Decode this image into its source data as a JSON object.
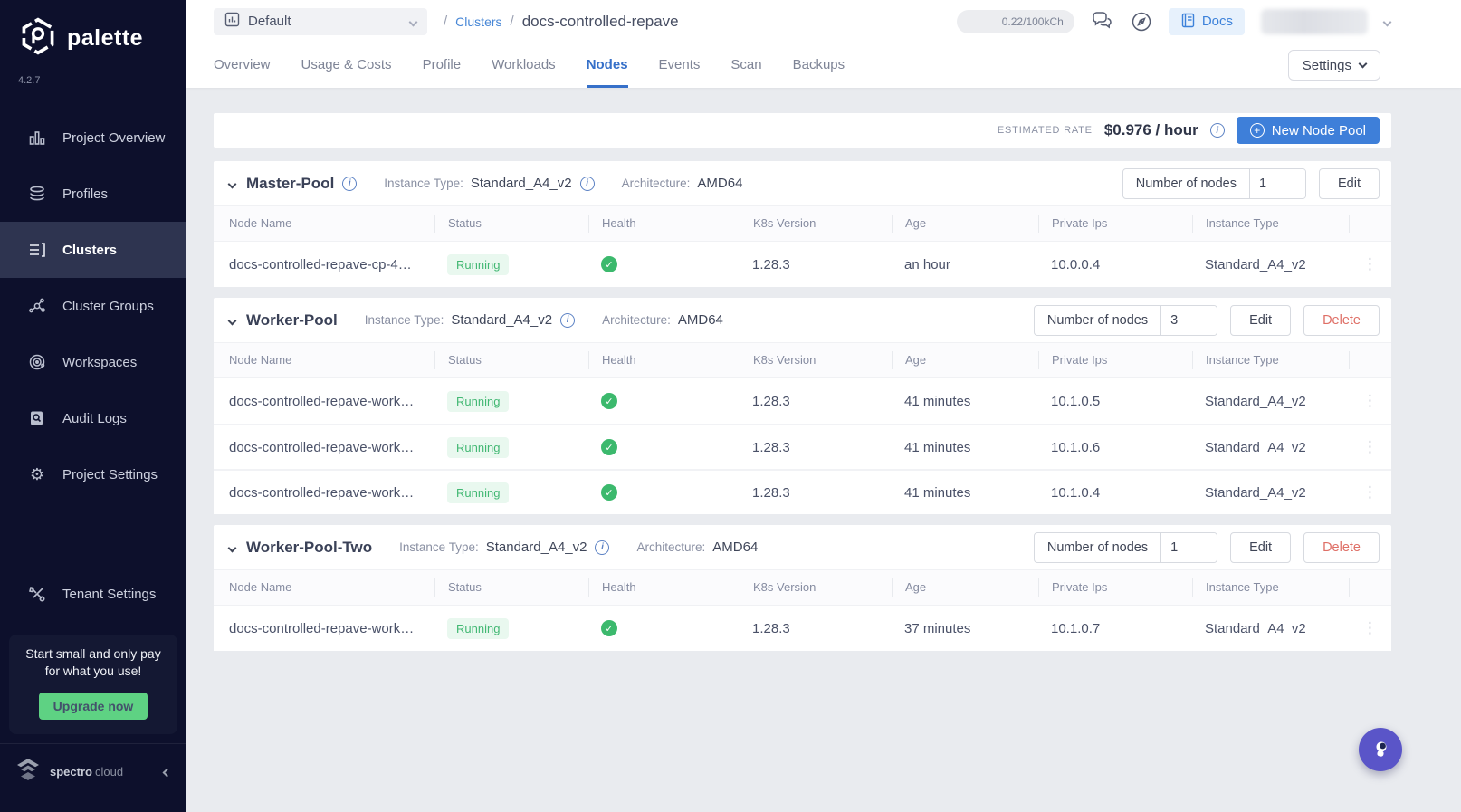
{
  "app": {
    "name": "palette",
    "version": "4.2.7"
  },
  "sidebar": {
    "items": [
      {
        "label": "Project Overview"
      },
      {
        "label": "Profiles"
      },
      {
        "label": "Clusters"
      },
      {
        "label": "Cluster Groups"
      },
      {
        "label": "Workspaces"
      },
      {
        "label": "Audit Logs"
      },
      {
        "label": "Project Settings"
      },
      {
        "label": "Tenant Settings"
      }
    ],
    "promo": {
      "text_line1": "Start small and only pay",
      "text_line2": "for what you use!",
      "button_label": "Upgrade now"
    },
    "brand": {
      "bold": "spectro",
      "light": "cloud"
    }
  },
  "header": {
    "project_selector": {
      "value": "Default"
    },
    "breadcrumb": {
      "separator": "/",
      "link": "Clusters",
      "current": "docs-controlled-repave"
    },
    "usage_pill": "0.22/100kCh",
    "docs_button": "Docs"
  },
  "tabs": {
    "items": [
      "Overview",
      "Usage & Costs",
      "Profile",
      "Workloads",
      "Nodes",
      "Events",
      "Scan",
      "Backups"
    ],
    "active": "Nodes",
    "settings_button": "Settings"
  },
  "rate_bar": {
    "label": "ESTIMATED RATE",
    "value": "$0.976 / hour",
    "new_pool_button": "New Node Pool"
  },
  "labels": {
    "instance_type": "Instance Type:",
    "architecture": "Architecture:",
    "number_of_nodes": "Number of nodes",
    "edit": "Edit",
    "delete": "Delete"
  },
  "table_headers": [
    "Node Name",
    "Status",
    "Health",
    "K8s Version",
    "Age",
    "Private Ips",
    "Instance Type"
  ],
  "pools": [
    {
      "name": "Master-Pool",
      "instance_type": "Standard_A4_v2",
      "architecture": "AMD64",
      "nodes_count": "1",
      "rows": [
        {
          "name": "docs-controlled-repave-cp-4…",
          "status": "Running",
          "k8s_version": "1.28.3",
          "age": "an hour",
          "private_ip": "10.0.0.4",
          "instance_type": "Standard_A4_v2"
        }
      ]
    },
    {
      "name": "Worker-Pool",
      "instance_type": "Standard_A4_v2",
      "architecture": "AMD64",
      "nodes_count": "3",
      "rows": [
        {
          "name": "docs-controlled-repave-work…",
          "status": "Running",
          "k8s_version": "1.28.3",
          "age": "41 minutes",
          "private_ip": "10.1.0.5",
          "instance_type": "Standard_A4_v2"
        },
        {
          "name": "docs-controlled-repave-work…",
          "status": "Running",
          "k8s_version": "1.28.3",
          "age": "41 minutes",
          "private_ip": "10.1.0.6",
          "instance_type": "Standard_A4_v2"
        },
        {
          "name": "docs-controlled-repave-work…",
          "status": "Running",
          "k8s_version": "1.28.3",
          "age": "41 minutes",
          "private_ip": "10.1.0.4",
          "instance_type": "Standard_A4_v2"
        }
      ]
    },
    {
      "name": "Worker-Pool-Two",
      "instance_type": "Standard_A4_v2",
      "architecture": "AMD64",
      "nodes_count": "1",
      "rows": [
        {
          "name": "docs-controlled-repave-work…",
          "status": "Running",
          "k8s_version": "1.28.3",
          "age": "37 minutes",
          "private_ip": "10.1.0.7",
          "instance_type": "Standard_A4_v2"
        }
      ]
    }
  ],
  "colors": {
    "accent_blue": "#3e7fd9",
    "green": "#3cb96d",
    "delete_red": "#df6f66",
    "sidebar_bg": "#0d102c",
    "upgrade_green": "#5ed283"
  }
}
